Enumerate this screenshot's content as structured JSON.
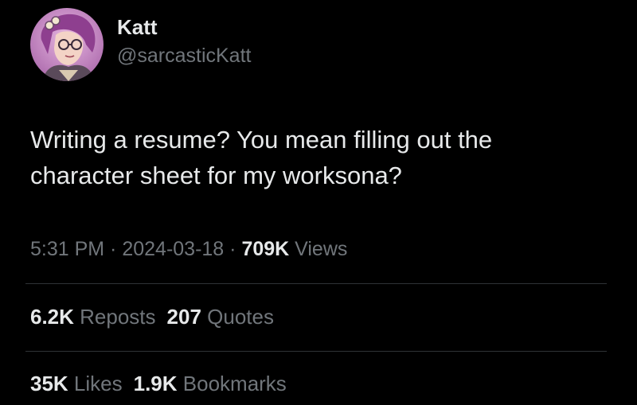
{
  "colors": {
    "background": "#000000",
    "primary_text": "#e7e9ea",
    "secondary_text": "#71767b",
    "divider": "#2f3336"
  },
  "author": {
    "display_name": "Katt",
    "handle": "@sarcasticKatt",
    "avatar_icon": "avatar-illustration-icon"
  },
  "tweet": {
    "text": "Writing a resume? You mean filling out the\ncharacter sheet for my worksona?"
  },
  "meta": {
    "time": "5:31 PM",
    "sep1": " · ",
    "date": "2024-03-18",
    "sep2": " · ",
    "views_count": "709K",
    "views_label": " Views"
  },
  "stats": {
    "reposts_count": "6.2K",
    "reposts_label": " Reposts",
    "quotes_count": "207",
    "quotes_label": " Quotes",
    "likes_count": "35K",
    "likes_label": " Likes",
    "bookmarks_count": "1.9K",
    "bookmarks_label": " Bookmarks"
  }
}
